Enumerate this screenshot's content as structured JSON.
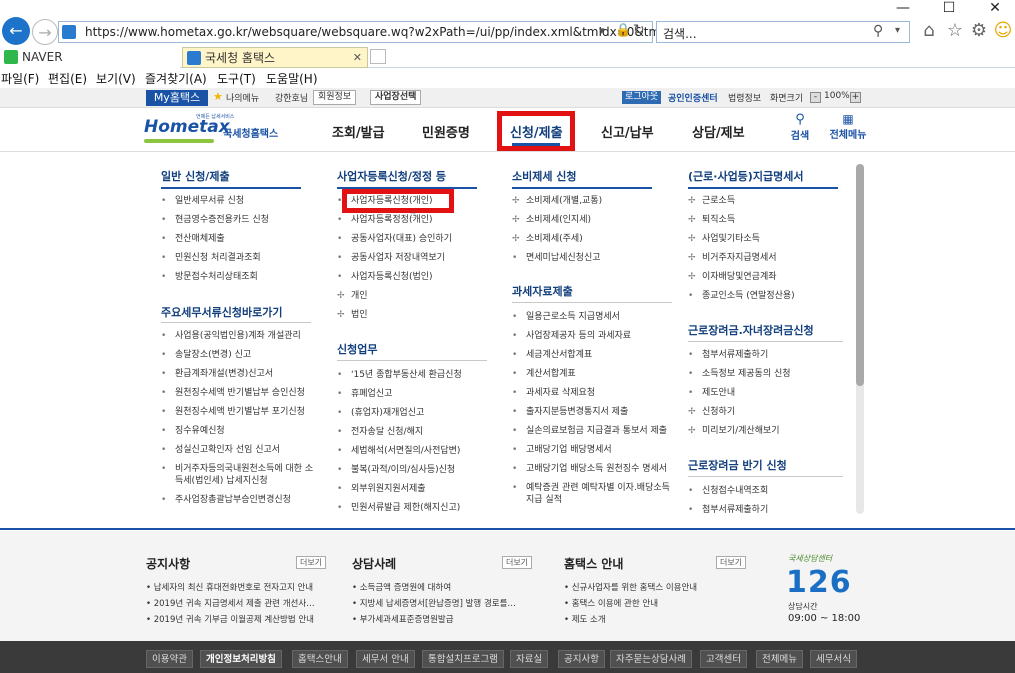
{
  "browser": {
    "url": "https://www.hometax.go.kr/websquare/websquare.wq?w2xPath=/ui/pp/index.xml&tmIdx=0&tm2lId",
    "search_placeholder": "검색...",
    "tabs": [
      {
        "label": "NAVER"
      },
      {
        "label": "국세청 홈택스"
      }
    ],
    "menu": [
      "파일(F)",
      "편집(E)",
      "보기(V)",
      "즐겨찾기(A)",
      "도구(T)",
      "도움말(H)"
    ]
  },
  "sitebar": {
    "my": "My홈택스",
    "mymenu": "나의메뉴",
    "user": "강한호님",
    "member": "회원정보",
    "biz": "사업장선택",
    "logout": "로그아웃",
    "cert": "공인인증센터",
    "law": "법령정보",
    "zoom_label": "화면크기",
    "zoom": "100%"
  },
  "header": {
    "logo_small": "언제든 납세서비스",
    "logo_main": "Hometax",
    "logo_sub": "국세청홈택스",
    "gnb": [
      "조회/발급",
      "민원증명",
      "신청/제출",
      "신고/납부",
      "상담/제보"
    ],
    "search": "검색",
    "all_menu": "전체메뉴"
  },
  "mega": {
    "col1": {
      "title": "일반 신청/제출",
      "items": [
        "일반세무서류 신청",
        "현금영수증전용카드 신청",
        "전산매체제출",
        "민원신청 처리결과조회",
        "방문접수처리상태조회"
      ],
      "title2": "주요세무서류신청바로가기",
      "items2": [
        "사업용(공익법인용)계좌 개설관리",
        "송달장소(변경) 신고",
        "환급계좌개설(변경)신고서",
        "원천징수세액 반기별납부 승인신청",
        "원천징수세액 반기별납부 포기신청",
        "징수유예신청",
        "성실신고확인자 선임 신고서",
        "비거주자등의국내원천소득에 대한 소",
        "득세(법인세) 납세지신청",
        "주사업장총괄납부승인변경신청"
      ]
    },
    "col2": {
      "title": "사업자등록신청/정정 등",
      "items": [
        "사업자등록신청(개인)",
        "사업자등록정정(개인)",
        "공동사업자(대표) 승인하기",
        "공동사업자 저장내역보기",
        "사업자등록신청(법인)",
        "개인",
        "법인"
      ],
      "title2": "신청업무",
      "items2": [
        "'15년 종합부동산세 환급신청",
        "휴폐업신고",
        "(휴업자)재개업신고",
        "전자송달 신청/해지",
        "세법해석(서면질의/사전답변)",
        "불복(과적/이의/심사등)신청",
        "외부위원지원서제출",
        "민원서류발급 제한(해지신고)"
      ]
    },
    "col3": {
      "title": "소비제세 신청",
      "items": [
        "소비제세(개별,교통)",
        "소비제세(인지세)",
        "소비제세(주세)",
        "면세미납세신청신고"
      ],
      "title2": "과세자료제출",
      "items2": [
        "일용근로소득 지급명세서",
        "사업장제공자 등의 과세자료",
        "세금계산서합계표",
        "계산서합계표",
        "과세자료 삭제요청",
        "출자지분등변경통지서 제출",
        "실손의료보험금 지급결과 통보서 제출",
        "고배당기업 배당명세서",
        "고배당기업 배당소득 원천징수 명세서",
        "예탁증권 관련 예탁자별 이자.배당소득",
        "지급 실적"
      ]
    },
    "col4": {
      "title": "(근로·사업등)지급명세서",
      "items": [
        "근로소득",
        "퇴직소득",
        "사업및기타소득",
        "비거주자지급명세서",
        "이자배당및연금계좌",
        "종교인소득 (연말정산용)"
      ],
      "title2": "근로장려금.자녀장려금신청",
      "items2": [
        "첨부서류제출하기",
        "소득정보 제공동의 신청",
        "제도안내",
        "신청하기",
        "미리보기/계산해보기"
      ],
      "title3": "근로장려금 반기 신청",
      "items3": [
        "신청접수내역조회",
        "첨부서류제출하기"
      ]
    }
  },
  "footer": {
    "more": "더보기",
    "notice": {
      "title": "공지사항",
      "items": [
        "납세자의 최신 휴대전화번호로 전자고지 안내",
        "2019년 귀속 지급명세서 제출 관련 개선사…",
        "2019년 귀속 기부금 이월공제 계산방법 안내"
      ]
    },
    "consult": {
      "title": "상담사례",
      "items": [
        "소득금액 증명원에 대하여",
        "지방세 납세증명서[완납증명] 발행 경로를…",
        "부가세과세표준증명원발급"
      ]
    },
    "guide": {
      "title": "홈택스 안내",
      "items": [
        "신규사업자를 위한 홈택스 이용안내",
        "홈택스 이용에 관한 안내",
        "제도 소개"
      ]
    },
    "call": {
      "label": "국세상담센터",
      "number": "126",
      "hours_label": "상담시간",
      "hours": "09:00 ~ 18:00"
    }
  },
  "bottom": [
    "이용약관",
    "개인정보처리방침",
    "홈택스안내",
    "세무서 안내",
    "통합설치프로그램",
    "자료실",
    "공지사항",
    "자주묻는상담사례",
    "고객센터",
    "전체메뉴",
    "세무서식"
  ]
}
